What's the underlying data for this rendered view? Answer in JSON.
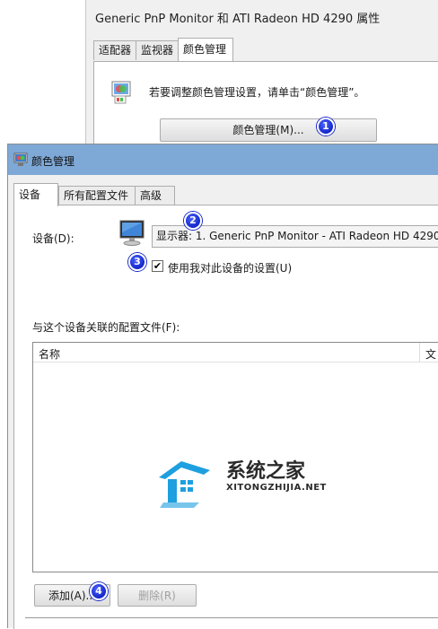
{
  "back_window": {
    "title": "Generic PnP Monitor 和 ATI Radeon HD 4290 属性",
    "tabs": [
      "适配器",
      "监视器",
      "颜色管理"
    ],
    "info_text": "若要调整颜色管理设置，请单击“颜色管理”。",
    "color_mgmt_button": "颜色管理(M)..."
  },
  "front_window": {
    "title": "颜色管理",
    "tabs": [
      "设备",
      "所有配置文件",
      "高级"
    ],
    "device_label": "设备(D):",
    "device_select_value": "显示器: 1. Generic PnP Monitor - ATI Radeon HD 4290",
    "checkbox_label": "使用我对此设备的设置(U)",
    "checkbox_mark": "✔",
    "profiles_label": "与这个设备关联的配置文件(F):",
    "list_columns": [
      "名称",
      "文"
    ],
    "add_button": "添加(A)...",
    "remove_button": "删除(R)"
  },
  "badges": [
    "1",
    "2",
    "3",
    "4"
  ],
  "watermark": {
    "cn": "系统之家",
    "en": "XITONGZHIJIA.NET"
  },
  "colors": {
    "titlebar": "#7ea8d6",
    "badge": "#1426c9",
    "watermark_blue": "#1e9fe0"
  }
}
